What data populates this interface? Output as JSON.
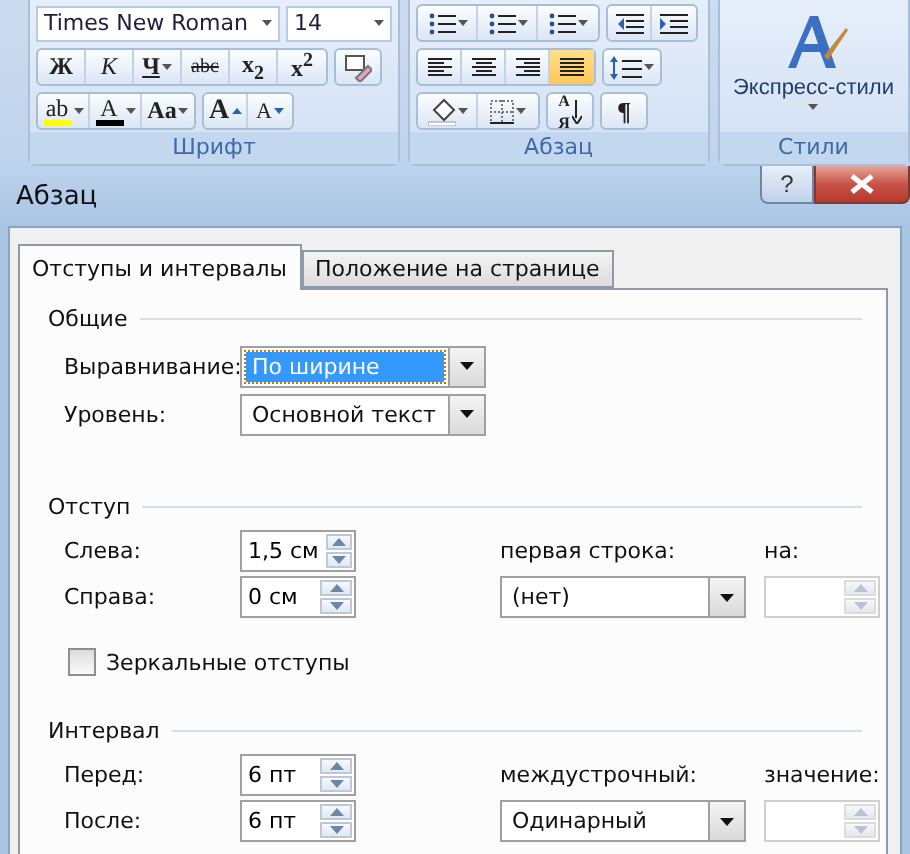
{
  "ribbon": {
    "groups": [
      {
        "kind": "font",
        "label": "Шрифт",
        "font_name": "Times New Roman",
        "font_size": "14",
        "format_buttons": [
          {
            "label": "Ж",
            "dropdown": false
          },
          {
            "label": "К",
            "dropdown": false
          },
          {
            "label": "Ч",
            "dropdown": true
          },
          {
            "label": "abc",
            "dropdown": false
          },
          {
            "label": "x$_{2}$",
            "dropdown": false
          },
          {
            "label": "x$^{2}$",
            "dropdown": false
          }
        ],
        "color_buttons": [
          {
            "label": "ab",
            "color": "#ffff00",
            "dropdown": true
          },
          {
            "label": "A",
            "color": "#000000",
            "dropdown": true
          },
          {
            "label": "Aa",
            "dropdown": true
          }
        ],
        "size_buttons": [
          {
            "label": "A"
          },
          {
            "label": "A"
          }
        ]
      },
      {
        "kind": "paragraph",
        "label": "Абзац",
        "align_buttons": [
          {
            "selected": false
          },
          {
            "selected": false
          },
          {
            "selected": false
          },
          {
            "selected": true
          }
        ],
        "sort_button": {
          "top": "А",
          "bottom": "Я"
        },
        "marks_button": "¶"
      },
      {
        "kind": "styles",
        "label": "Стили",
        "button": "Экспресс-стили"
      }
    ]
  },
  "dialog": {
    "title": "Абзац",
    "help_button": "?",
    "tabs": [
      {
        "label": "Отступы и интервалы",
        "selected": true
      },
      {
        "label": "Положение на странице",
        "selected": false
      }
    ],
    "general": {
      "title": "Общие",
      "alignment": {
        "label": "Выравнивание:",
        "value": "По ширине",
        "focused": true
      },
      "level": {
        "label": "Уровень:",
        "value": "Основной текст",
        "focused": false
      }
    },
    "indent": {
      "title": "Отступ",
      "left": {
        "label": "Слева:",
        "value": "1,5 см",
        "disabled": false
      },
      "right": {
        "label": "Справа:",
        "value": "0 см",
        "disabled": false
      },
      "first_line": {
        "label": "первая строка:",
        "value": "(нет)",
        "focused": false
      },
      "by": {
        "label": "на:",
        "disabled": true
      },
      "mirror": {
        "label": "Зеркальные отступы",
        "checked": false
      }
    },
    "spacing": {
      "title": "Интервал",
      "before": {
        "label": "Перед:",
        "value": "6 пт",
        "disabled": false
      },
      "after": {
        "label": "После:",
        "value": "6 пт",
        "disabled": false
      },
      "line": {
        "label": "междустрочный:",
        "value": "Одинарный",
        "focused": false
      },
      "at": {
        "label": "значение:",
        "disabled": true
      }
    }
  }
}
